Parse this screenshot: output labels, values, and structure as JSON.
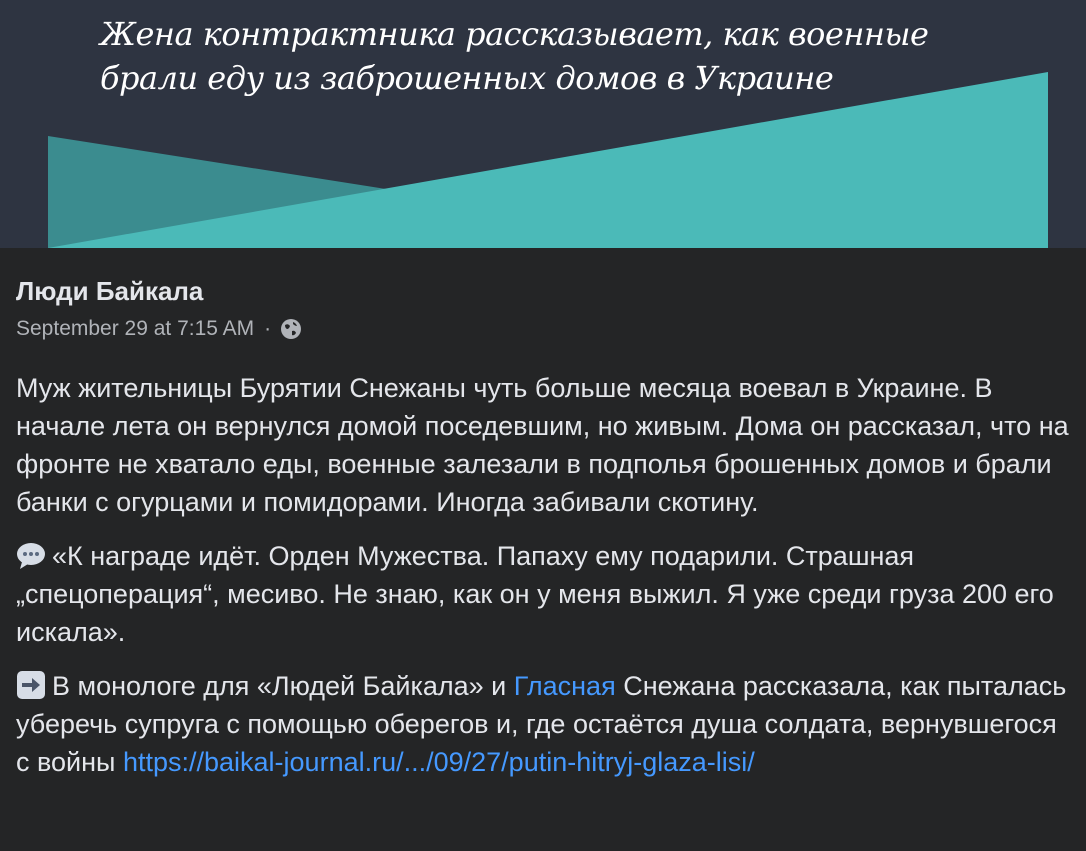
{
  "banner": {
    "title": "Жена контрактника рассказывает, как военные\n брали еду из заброшенных домов в Украине",
    "colors": {
      "background": "#2e3441",
      "teal": "#4bbab8",
      "teal_dark": "#3b8c8f"
    }
  },
  "post": {
    "author": "Люди Байкала",
    "timestamp": "September 29 at 7:15 AM",
    "separator": "·",
    "audience_icon": "globe-icon",
    "paragraph1": "Муж жительницы Бурятии Снежаны чуть больше месяца воевал в Украине. В начале лета он вернулся домой поседевшим, но живым. Дома он рассказал, что на фронте не хватало еды, военные залезали в подполья брошенных домов и брали банки с огурцами и помидорами. Иногда забивали скотину.",
    "paragraph2_icon": "speech-balloon-icon",
    "paragraph2": "«К награде идёт. Орден Мужества. Папаху ему подарили. Страшная „спецоперация“, месиво. Не знаю, как он у меня выжил. Я уже среди груза 200 его искала».",
    "paragraph3_icon": "right-arrow-icon",
    "paragraph3_part1": "В монологе для «Людей Байкала» и ",
    "paragraph3_link1": "Гласная",
    "paragraph3_part2": " Снежана рассказала, как пыталась уберечь супруга с помощью оберегов и, где остаётся душа солдата, вернувшегося с войны ",
    "paragraph3_link2": "https://baikal-journal.ru/.../09/27/putin-hitryj-glaza-lisi/",
    "link_color": "#4599ff"
  }
}
